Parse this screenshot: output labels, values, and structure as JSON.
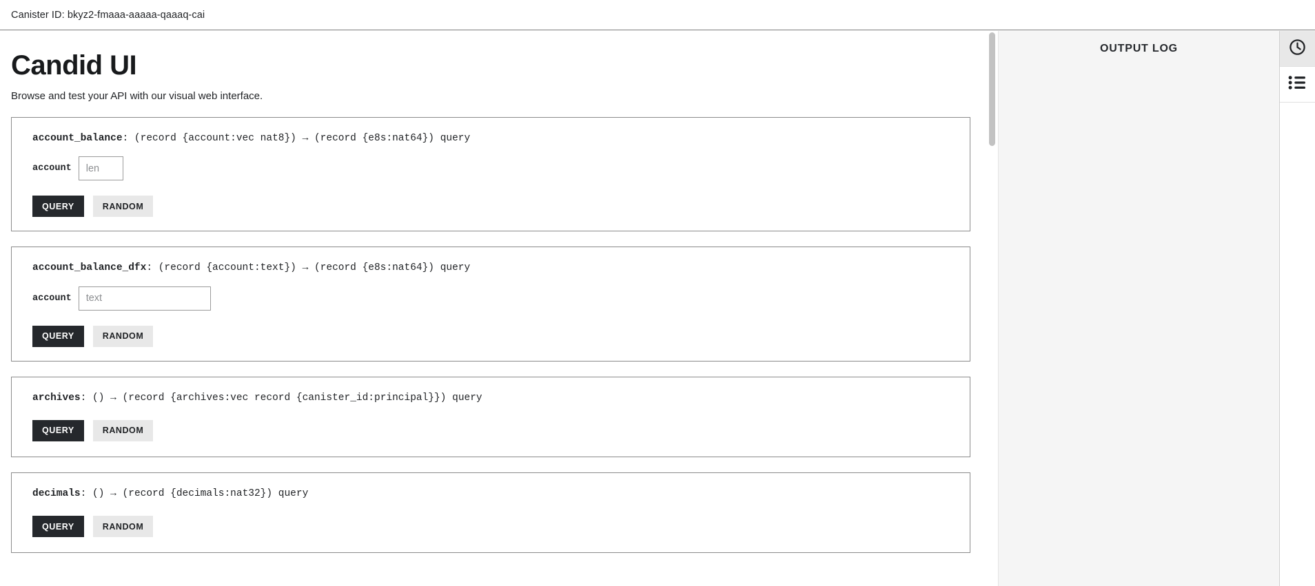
{
  "topbar": {
    "canister_label": "Canister ID: bkyz2-fmaaa-aaaaa-qaaaq-cai"
  },
  "header": {
    "title": "Candid UI",
    "subtitle": "Browse and test your API with our visual web interface."
  },
  "buttons": {
    "query_label": "QUERY",
    "random_label": "RANDOM"
  },
  "methods": [
    {
      "name": "account_balance",
      "signature": ": (record {account:vec nat8}) → (record {e8s:nat64}) query",
      "arg_label": "account",
      "arg_placeholder": "len",
      "arg_value": "",
      "arg_width": "short",
      "has_input": true
    },
    {
      "name": "account_balance_dfx",
      "signature": ": (record {account:text}) → (record {e8s:nat64}) query",
      "arg_label": "account",
      "arg_placeholder": "text",
      "arg_value": "",
      "arg_width": "long",
      "has_input": true
    },
    {
      "name": "archives",
      "signature": ": () → (record {archives:vec record {canister_id:principal}}) query",
      "arg_label": "",
      "arg_placeholder": "",
      "arg_value": "",
      "arg_width": "",
      "has_input": false
    },
    {
      "name": "decimals",
      "signature": ": () → (record {decimals:nat32}) query",
      "arg_label": "",
      "arg_placeholder": "",
      "arg_value": "",
      "arg_width": "",
      "has_input": false
    }
  ],
  "output_pane": {
    "title": "OUTPUT LOG",
    "entries": []
  },
  "icon_rail": {
    "items": [
      {
        "icon": "clock-icon",
        "active": true
      },
      {
        "icon": "list-icon",
        "active": false
      }
    ]
  },
  "colors": {
    "primary_button": "#25282c",
    "secondary_button": "#e8e8e8",
    "output_background": "#f5f5f5",
    "card_border": "#8a8a8a"
  }
}
